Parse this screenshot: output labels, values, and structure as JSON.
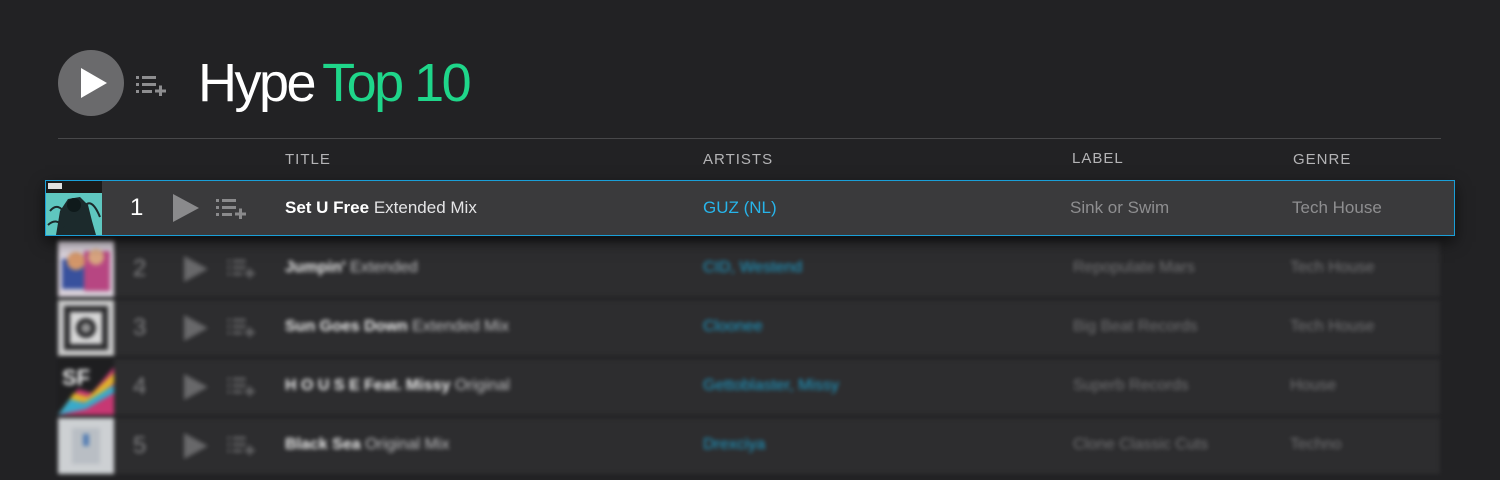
{
  "header": {
    "title_main": "Hype",
    "title_accent": "Top 10",
    "play_icon": "play-icon",
    "queue_icon": "add-to-queue-icon"
  },
  "columns": {
    "title": "TITLE",
    "artists": "ARTISTS",
    "label": "LABEL",
    "genre": "GENRE"
  },
  "tracks": [
    {
      "rank": "1",
      "name": "Set U Free",
      "mix": "Extended Mix",
      "artists": "GUZ (NL)",
      "label": "Sink or Swim",
      "genre": "Tech House"
    },
    {
      "rank": "2",
      "name": "Jumpin'",
      "mix": "Extended",
      "artists": "CID, Westend",
      "label": "Repopulate Mars",
      "genre": "Tech House"
    },
    {
      "rank": "3",
      "name": "Sun Goes Down",
      "mix": "Extended Mix",
      "artists": "Cloonee",
      "label": "Big Beat Records",
      "genre": "Tech House"
    },
    {
      "rank": "4",
      "name": "H O U S E Feat. Missy",
      "mix": "Original",
      "artists": "Gettoblaster, Missy",
      "label": "Superb Records",
      "genre": "House"
    },
    {
      "rank": "5",
      "name": "Black Sea",
      "mix": "Original Mix",
      "artists": "Drexciya",
      "label": "Clone Classic Cuts",
      "genre": "Techno"
    }
  ],
  "colors": {
    "accent_green": "#1fd68a",
    "artist_blue": "#1ea9d9",
    "highlight_border": "#1a9fd8",
    "background": "#222224"
  }
}
